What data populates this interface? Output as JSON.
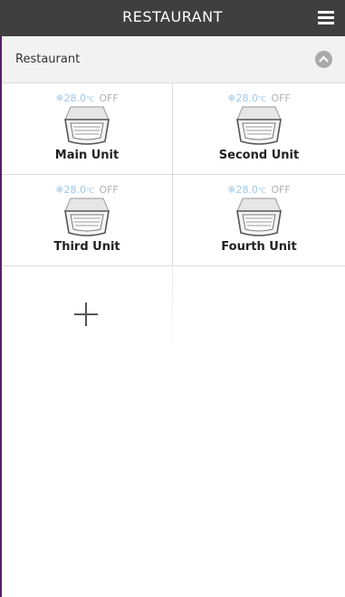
{
  "header": {
    "title": "RESTAURANT",
    "menu_icon": "hamburger-menu-icon"
  },
  "section": {
    "title": "Restaurant",
    "toggle_icon": "chevron-up-circle-icon"
  },
  "units": [
    {
      "temp": "28.0",
      "unit": "℃",
      "state": "OFF",
      "name": "Main Unit"
    },
    {
      "temp": "28.0",
      "unit": "℃",
      "state": "OFF",
      "name": "Second Unit"
    },
    {
      "temp": "28.0",
      "unit": "℃",
      "state": "OFF",
      "name": "Third Unit"
    },
    {
      "temp": "28.0",
      "unit": "℃",
      "state": "OFF",
      "name": "Fourth Unit"
    }
  ],
  "add": {
    "icon": "plus-icon"
  },
  "colors": {
    "header_bg": "#3f3f3f",
    "section_bg": "#f2f2f2",
    "snow": "#a0c8e8"
  }
}
